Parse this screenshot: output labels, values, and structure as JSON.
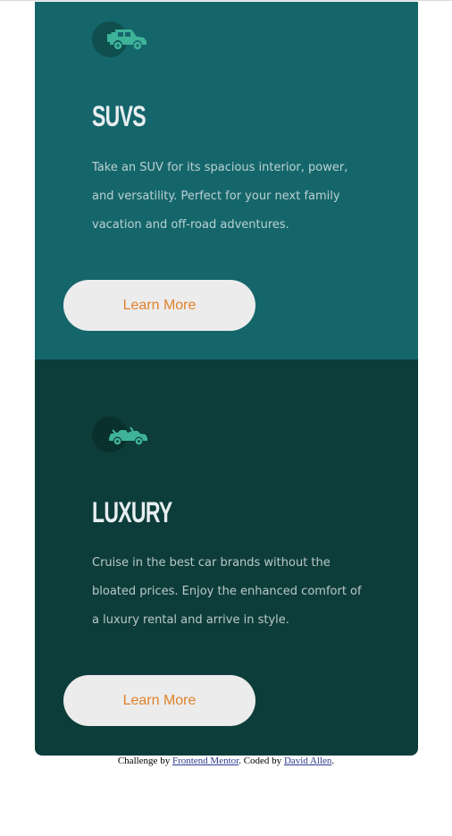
{
  "cards": [
    {
      "id": "suvs",
      "icon": "suv-car-icon",
      "title": "SUVS",
      "text": "Take an SUV for its spacious interior, power, and versatility. Perfect for your next family vacation and off-road adventures.",
      "button_label": "Learn More",
      "background": "#15666b"
    },
    {
      "id": "luxury",
      "icon": "luxury-car-icon",
      "title": "LUXURY",
      "text": "Cruise in the best car brands without the bloated prices. Enjoy the enhanced comfort of a luxury rental and arrive in style.",
      "button_label": "Learn More",
      "background": "#0d3d3a"
    }
  ],
  "colors": {
    "button_text": "#e0822b",
    "button_bg": "#ececec",
    "icon_fill": "#3fb29a"
  },
  "attribution": {
    "prefix": "Challenge by ",
    "link1": "Frontend Mentor",
    "middle": ". Coded by ",
    "link2": "David Allen",
    "suffix": "."
  }
}
